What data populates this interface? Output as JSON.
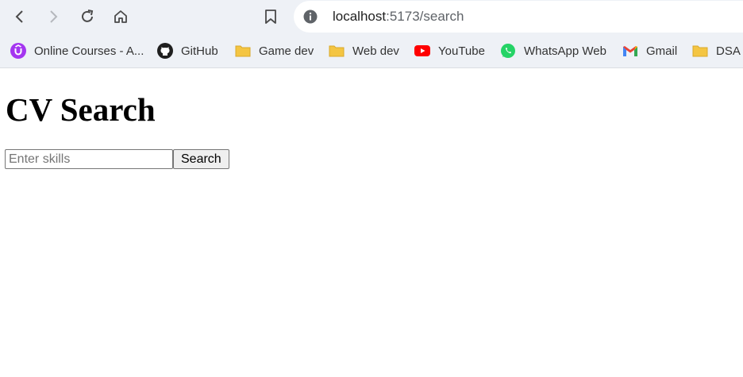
{
  "browser": {
    "url_host": "localhost",
    "url_path": ":5173/search",
    "bookmarks": [
      {
        "label": "Online Courses - A...",
        "icon": "udemy-icon"
      },
      {
        "label": "GitHub",
        "icon": "github-icon"
      },
      {
        "label": "Game dev",
        "icon": "folder-icon"
      },
      {
        "label": "Web dev",
        "icon": "folder-icon"
      },
      {
        "label": "YouTube",
        "icon": "youtube-icon"
      },
      {
        "label": "WhatsApp Web",
        "icon": "whatsapp-icon"
      },
      {
        "label": "Gmail",
        "icon": "gmail-icon"
      },
      {
        "label": "DSA",
        "icon": "folder-icon"
      }
    ]
  },
  "page": {
    "title": "CV Search",
    "search_placeholder": "Enter skills",
    "search_value": "",
    "search_button": "Search"
  },
  "colors": {
    "chrome_bg": "#eef1f6",
    "folder": "#f4c542",
    "youtube": "#ff0000",
    "whatsapp": "#25d366",
    "udemy": "#a435f0"
  }
}
